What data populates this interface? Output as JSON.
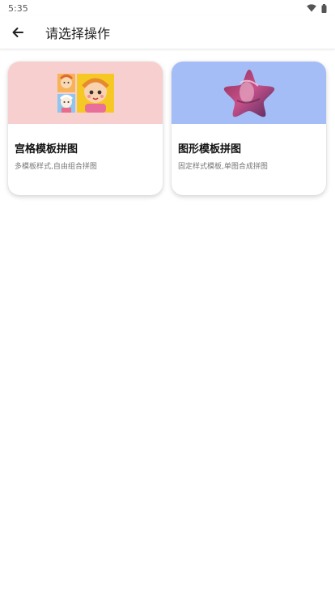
{
  "status_bar": {
    "time": "5:35",
    "icons": [
      "wifi-icon",
      "battery-icon"
    ]
  },
  "app_bar": {
    "back_icon": "arrow-left-icon",
    "title": "请选择操作"
  },
  "cards": [
    {
      "title": "宫格模板拼图",
      "description": "多模板样式,自由组合拼图",
      "banner_color": "#f8cfcf",
      "thumbnail": "grid-collage-thumbnail"
    },
    {
      "title": "图形模板拼图",
      "description": "固定样式模板,单图合成拼图",
      "banner_color": "#a5bdf6",
      "thumbnail": "star-shape-thumbnail"
    }
  ]
}
